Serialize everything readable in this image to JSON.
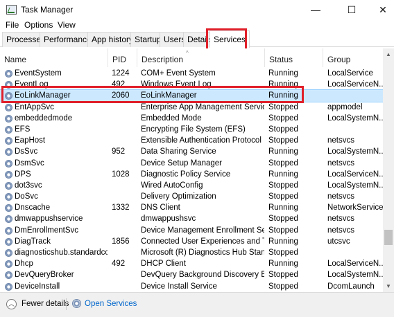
{
  "window": {
    "title": "Task Manager",
    "controls": {
      "minimize": "—",
      "maximize": "☐",
      "close": "✕"
    }
  },
  "menu": [
    "File",
    "Options",
    "View"
  ],
  "tabs": [
    "Processes",
    "Performance",
    "App history",
    "Startup",
    "Users",
    "Details",
    "Services"
  ],
  "active_tab": "Services",
  "table": {
    "columns": [
      "Name",
      "PID",
      "Description",
      "Status",
      "Group"
    ],
    "rows": [
      {
        "name": "EventSystem",
        "pid": "1224",
        "description": "COM+ Event System",
        "status": "Running",
        "group": "LocalService"
      },
      {
        "name": "EventLog",
        "pid": "492",
        "description": "Windows Event Log",
        "status": "Running",
        "group": "LocalServiceN..."
      },
      {
        "name": "EoLinkManager",
        "pid": "2060",
        "description": "EoLinkManager",
        "status": "Running",
        "group": ""
      },
      {
        "name": "EntAppSvc",
        "pid": "",
        "description": "Enterprise App Management Service",
        "status": "Stopped",
        "group": "appmodel"
      },
      {
        "name": "embeddedmode",
        "pid": "",
        "description": "Embedded Mode",
        "status": "Stopped",
        "group": "LocalSystemN..."
      },
      {
        "name": "EFS",
        "pid": "",
        "description": "Encrypting File System (EFS)",
        "status": "Stopped",
        "group": ""
      },
      {
        "name": "EapHost",
        "pid": "",
        "description": "Extensible Authentication Protocol",
        "status": "Stopped",
        "group": "netsvcs"
      },
      {
        "name": "DsSvc",
        "pid": "952",
        "description": "Data Sharing Service",
        "status": "Running",
        "group": "LocalSystemN..."
      },
      {
        "name": "DsmSvc",
        "pid": "",
        "description": "Device Setup Manager",
        "status": "Stopped",
        "group": "netsvcs"
      },
      {
        "name": "DPS",
        "pid": "1028",
        "description": "Diagnostic Policy Service",
        "status": "Running",
        "group": "LocalServiceN..."
      },
      {
        "name": "dot3svc",
        "pid": "",
        "description": "Wired AutoConfig",
        "status": "Stopped",
        "group": "LocalSystemN..."
      },
      {
        "name": "DoSvc",
        "pid": "",
        "description": "Delivery Optimization",
        "status": "Stopped",
        "group": "netsvcs"
      },
      {
        "name": "Dnscache",
        "pid": "1332",
        "description": "DNS Client",
        "status": "Running",
        "group": "NetworkService"
      },
      {
        "name": "dmwappushservice",
        "pid": "",
        "description": "dmwappushsvc",
        "status": "Stopped",
        "group": "netsvcs"
      },
      {
        "name": "DmEnrollmentSvc",
        "pid": "",
        "description": "Device Management Enrollment Ser...",
        "status": "Stopped",
        "group": "netsvcs"
      },
      {
        "name": "DiagTrack",
        "pid": "1856",
        "description": "Connected User Experiences and Tel...",
        "status": "Running",
        "group": "utcsvc"
      },
      {
        "name": "diagnosticshub.standardco...",
        "pid": "",
        "description": "Microsoft (R) Diagnostics Hub Stand...",
        "status": "Stopped",
        "group": ""
      },
      {
        "name": "Dhcp",
        "pid": "492",
        "description": "DHCP Client",
        "status": "Running",
        "group": "LocalServiceN..."
      },
      {
        "name": "DevQueryBroker",
        "pid": "",
        "description": "DevQuery Background Discovery Br...",
        "status": "Stopped",
        "group": "LocalSystemN..."
      },
      {
        "name": "DeviceInstall",
        "pid": "",
        "description": "Device Install Service",
        "status": "Stopped",
        "group": "DcomLaunch"
      }
    ]
  },
  "footer": {
    "fewer_details": "Fewer details",
    "open_services": "Open Services"
  },
  "colors": {
    "annotation": "#e0202a",
    "selection": "#cce8ff",
    "link": "#0066cc"
  },
  "selected_row": "EoLinkManager"
}
